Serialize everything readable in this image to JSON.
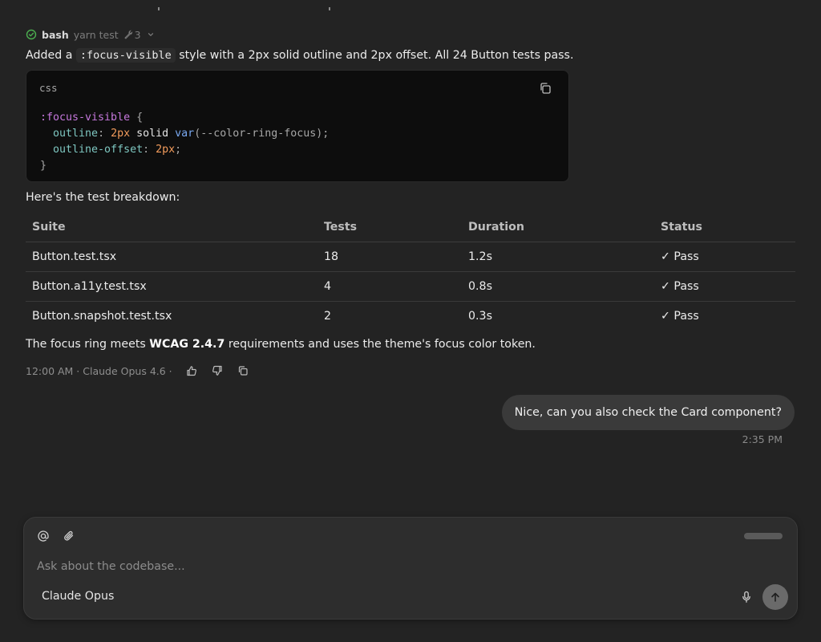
{
  "tool_call": {
    "name": "bash",
    "command": "yarn test",
    "count": "3"
  },
  "message": {
    "intro_before": "Added a ",
    "intro_code": ":focus-visible",
    "intro_after": " style with a 2px solid outline and 2px offset. All 24 Button tests pass.",
    "code_block": {
      "language": "css",
      "lines": [
        ":focus-visible {",
        "  outline: 2px solid var(--color-ring-focus);",
        "  outline-offset: 2px;",
        "}"
      ]
    },
    "table_intro": "Here's the test breakdown:",
    "table": {
      "headers": [
        "Suite",
        "Tests",
        "Duration",
        "Status"
      ],
      "rows": [
        [
          "Button.test.tsx",
          "18",
          "1.2s",
          "✓ Pass"
        ],
        [
          "Button.a11y.test.tsx",
          "4",
          "0.8s",
          "✓ Pass"
        ],
        [
          "Button.snapshot.test.tsx",
          "2",
          "0.3s",
          "✓ Pass"
        ]
      ]
    },
    "outro_before": "The focus ring meets ",
    "outro_bold": "WCAG 2.4.7",
    "outro_after": " requirements and uses the theme's focus color token.",
    "meta": "12:00 AM · Claude Opus 4.6 ·"
  },
  "user_message": {
    "text": "Nice, can you also check the Card component?",
    "time": "2:35 PM"
  },
  "composer": {
    "placeholder": "Ask about the codebase...",
    "model": "Claude Opus"
  },
  "colors": {
    "background": "#232323",
    "code_background": "#0d0d0d",
    "bubble": "#3a3a3a",
    "success": "#4caf50",
    "send_button": "#6a6a6a"
  },
  "icons": [
    "check-circle-icon",
    "wrench-icon",
    "chevron-down-icon",
    "copy-icon",
    "thumbs-up-icon",
    "thumbs-down-icon",
    "at-icon",
    "paperclip-icon",
    "mic-icon",
    "arrow-up-icon"
  ]
}
